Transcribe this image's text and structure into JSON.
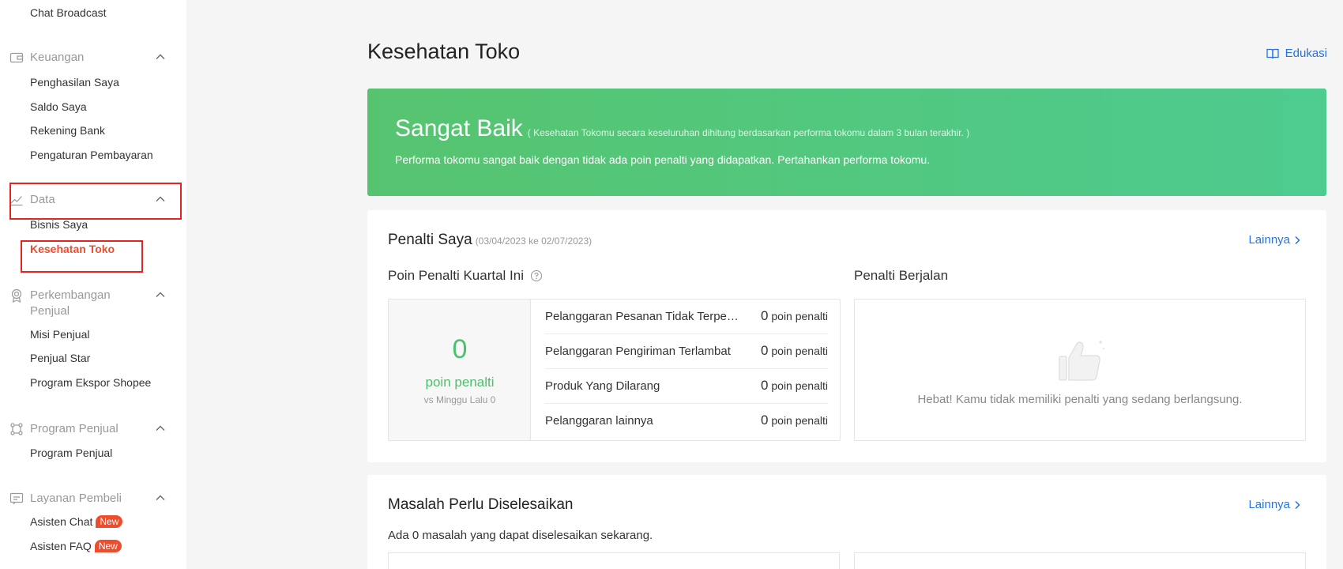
{
  "sidebar": {
    "top_item": "Chat Broadcast",
    "groups": [
      {
        "label": "Keuangan",
        "icon": "wallet-icon",
        "items": [
          "Penghasilan Saya",
          "Saldo Saya",
          "Rekening Bank",
          "Pengaturan Pembayaran"
        ]
      },
      {
        "label": "Data",
        "icon": "chart-line-icon",
        "items": [
          "Bisnis Saya",
          "Kesehatan Toko"
        ]
      },
      {
        "label": "Perkembangan Penjual",
        "icon": "medal-icon",
        "items": [
          "Misi Penjual",
          "Penjual Star",
          "Program Ekspor Shopee"
        ]
      },
      {
        "label": "Program Penjual",
        "icon": "program-icon",
        "items": [
          "Program Penjual"
        ]
      },
      {
        "label": "Layanan Pembeli",
        "icon": "chat-icon",
        "items": [
          "Asisten Chat",
          "Asisten FAQ"
        ]
      }
    ],
    "badge_new": "New",
    "active_item": "Kesehatan Toko"
  },
  "header": {
    "title": "Kesehatan Toko",
    "edukasi_label": "Edukasi"
  },
  "banner": {
    "title": "Sangat Baik",
    "note": "( Kesehatan Tokomu secara keseluruhan dihitung berdasarkan performa tokomu dalam 3 bulan terakhir. )",
    "description": "Performa tokomu sangat baik dengan tidak ada poin penalti yang didapatkan. Pertahankan performa tokomu."
  },
  "penalty": {
    "title": "Penalti Saya",
    "date_range": "(03/04/2023 ke 02/07/2023)",
    "more_label": "Lainnya",
    "quarter_title": "Poin Penalti Kuartal Ini",
    "total_points": "0",
    "total_unit": "poin penalti",
    "vs_last_week": "vs Minggu Lalu 0",
    "rows": [
      {
        "label": "Pelanggaran Pesanan Tidak Terpenuhi",
        "value": "0",
        "unit": "poin penalti"
      },
      {
        "label": "Pelanggaran Pengiriman Terlambat",
        "value": "0",
        "unit": "poin penalti"
      },
      {
        "label": "Produk Yang Dilarang",
        "value": "0",
        "unit": "poin penalti"
      },
      {
        "label": "Pelanggaran lainnya",
        "value": "0",
        "unit": "poin penalti"
      }
    ],
    "running_title": "Penalti Berjalan",
    "running_empty": "Hebat! Kamu tidak memiliki penalti yang sedang berlangsung."
  },
  "issues": {
    "title": "Masalah Perlu Diselesaikan",
    "more_label": "Lainnya",
    "description": "Ada 0 masalah yang dapat diselesaikan sekarang."
  },
  "colors": {
    "accent": "#ee4d2d",
    "link": "#2673dd",
    "success": "#4cc06a",
    "highlight_box": "#e3241f"
  }
}
